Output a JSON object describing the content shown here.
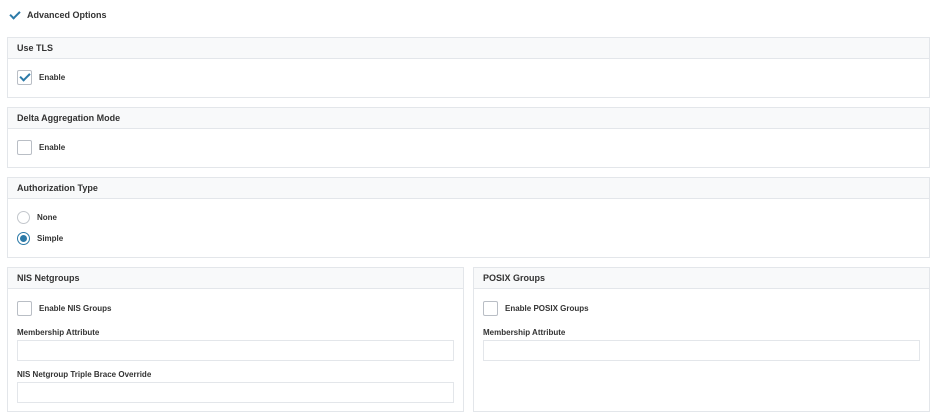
{
  "advanced": {
    "label": "Advanced Options",
    "checked": true
  },
  "tls": {
    "title": "Use TLS",
    "enable_label": "Enable",
    "checked": true
  },
  "delta": {
    "title": "Delta Aggregation Mode",
    "enable_label": "Enable",
    "checked": false
  },
  "auth": {
    "title": "Authorization Type",
    "options": [
      {
        "label": "None",
        "selected": false
      },
      {
        "label": "Simple",
        "selected": true
      }
    ]
  },
  "nis": {
    "title": "NIS Netgroups",
    "enable_label": "Enable NIS Groups",
    "checked": false,
    "membership_label": "Membership Attribute",
    "membership_value": "",
    "override_label": "NIS Netgroup Triple Brace Override",
    "override_value": ""
  },
  "posix": {
    "title": "POSIX Groups",
    "enable_label": "Enable POSIX Groups",
    "checked": false,
    "membership_label": "Membership Attribute",
    "membership_value": ""
  },
  "colors": {
    "accent": "#2c7aa8",
    "header_bg": "#f8f9fa",
    "border": "#e3e6ea"
  }
}
